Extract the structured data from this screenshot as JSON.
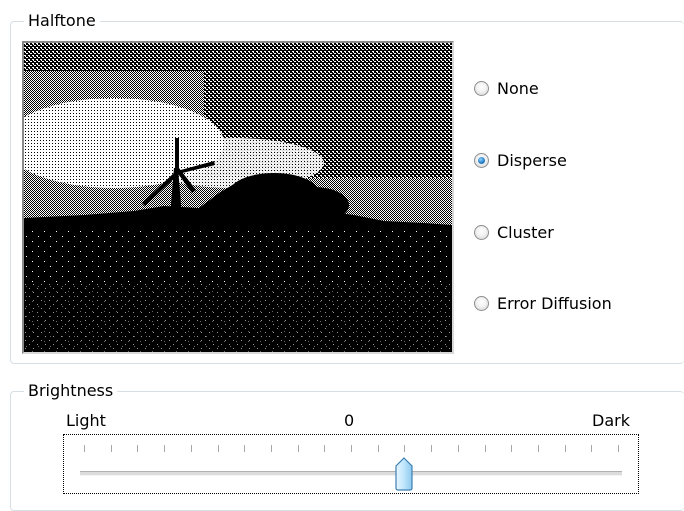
{
  "halftone": {
    "title": "Halftone",
    "options": [
      {
        "label": "None",
        "checked": false
      },
      {
        "label": "Disperse",
        "checked": true
      },
      {
        "label": "Cluster",
        "checked": false
      },
      {
        "label": "Error Diffusion",
        "checked": false
      }
    ]
  },
  "brightness": {
    "title": "Brightness",
    "min_label": "Light",
    "mid_label": "0",
    "max_label": "Dark",
    "tick_count": 21,
    "value_fraction": 0.6
  }
}
